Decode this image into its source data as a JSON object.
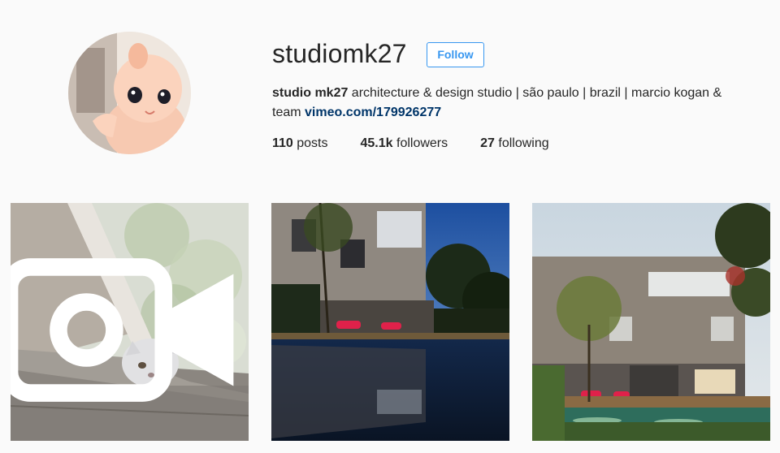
{
  "profile": {
    "username": "studiomk27",
    "follow_label": "Follow",
    "bio_name": "studio mk27",
    "bio_text": " architecture & design studio | são paulo | brazil | marcio kogan & team ",
    "bio_link": "vimeo.com/179926277",
    "stats": {
      "posts_count": "110",
      "posts_label": " posts",
      "followers_count": "45.1k",
      "followers_label": " followers",
      "following_count": "27",
      "following_label": " following"
    }
  },
  "posts": [
    {
      "kind": "video",
      "icon": "video-icon",
      "subject": "cat on concrete wall"
    },
    {
      "kind": "photo",
      "subject": "concrete house at dusk over pool"
    },
    {
      "kind": "photo",
      "subject": "concrete house with garden and pool"
    }
  ],
  "colors": {
    "accent": "#3897f0",
    "link": "#003569",
    "background": "#fafafa",
    "text": "#262626"
  }
}
